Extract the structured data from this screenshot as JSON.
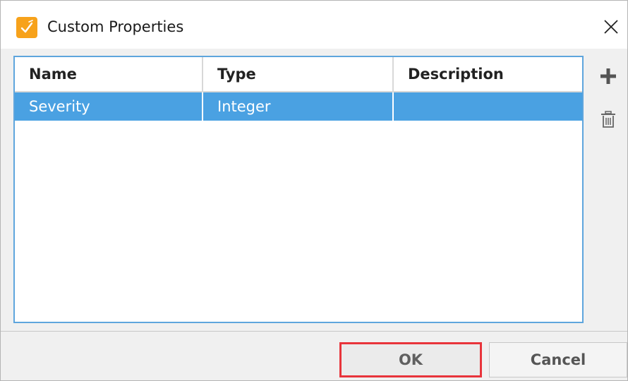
{
  "window": {
    "title": "Custom Properties",
    "app_icon": "checkmark-tool-icon",
    "accent": "#f7a21b"
  },
  "table": {
    "columns": [
      "Name",
      "Type",
      "Description"
    ],
    "rows": [
      {
        "name": "Severity",
        "type": "Integer",
        "description": "",
        "selected": true
      }
    ],
    "selection_color": "#4aa1e2",
    "border_color": "#5ea5dd"
  },
  "tools": {
    "add_icon": "plus-icon",
    "delete_icon": "trash-icon"
  },
  "buttons": {
    "ok_label": "OK",
    "cancel_label": "Cancel",
    "highlight_color": "#e8343b"
  }
}
